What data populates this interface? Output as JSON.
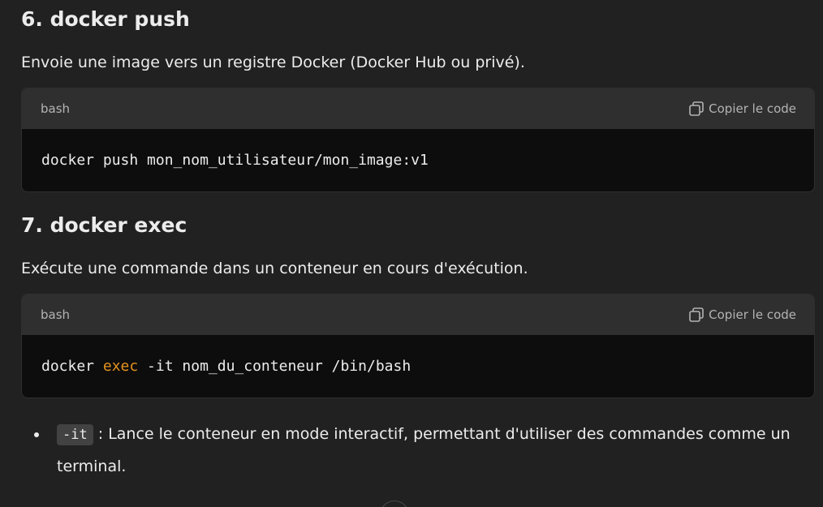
{
  "sections": [
    {
      "heading": "6. docker push",
      "description": "Envoie une image vers un registre Docker (Docker Hub ou privé).",
      "code": {
        "language": "bash",
        "copy_label": "Copier le code",
        "tokens": [
          {
            "text": "docker push mon_nom_utilisateur/mon_image:v1",
            "highlight": false
          }
        ]
      }
    },
    {
      "heading": "7. docker exec",
      "description": "Exécute une commande dans un conteneur en cours d'exécution.",
      "code": {
        "language": "bash",
        "copy_label": "Copier le code",
        "tokens": [
          {
            "text": "docker ",
            "highlight": false
          },
          {
            "text": "exec",
            "highlight": true
          },
          {
            "text": " -it nom_du_conteneur /bin/bash",
            "highlight": false
          }
        ]
      }
    }
  ],
  "bullets": [
    {
      "code": "-it",
      "text_line1": " : Lance le conteneur en mode interactif, permettant d'utiliser des commandes comme un",
      "text_line2": "terminal."
    }
  ],
  "icons": {
    "copy": "copy-icon",
    "scroll": "scroll-down-icon"
  },
  "colors": {
    "background": "#212121",
    "code_header": "#2f2f2f",
    "code_body": "#0d0d0d",
    "keyword": "#e5921f",
    "inline_code_bg": "#424242"
  }
}
